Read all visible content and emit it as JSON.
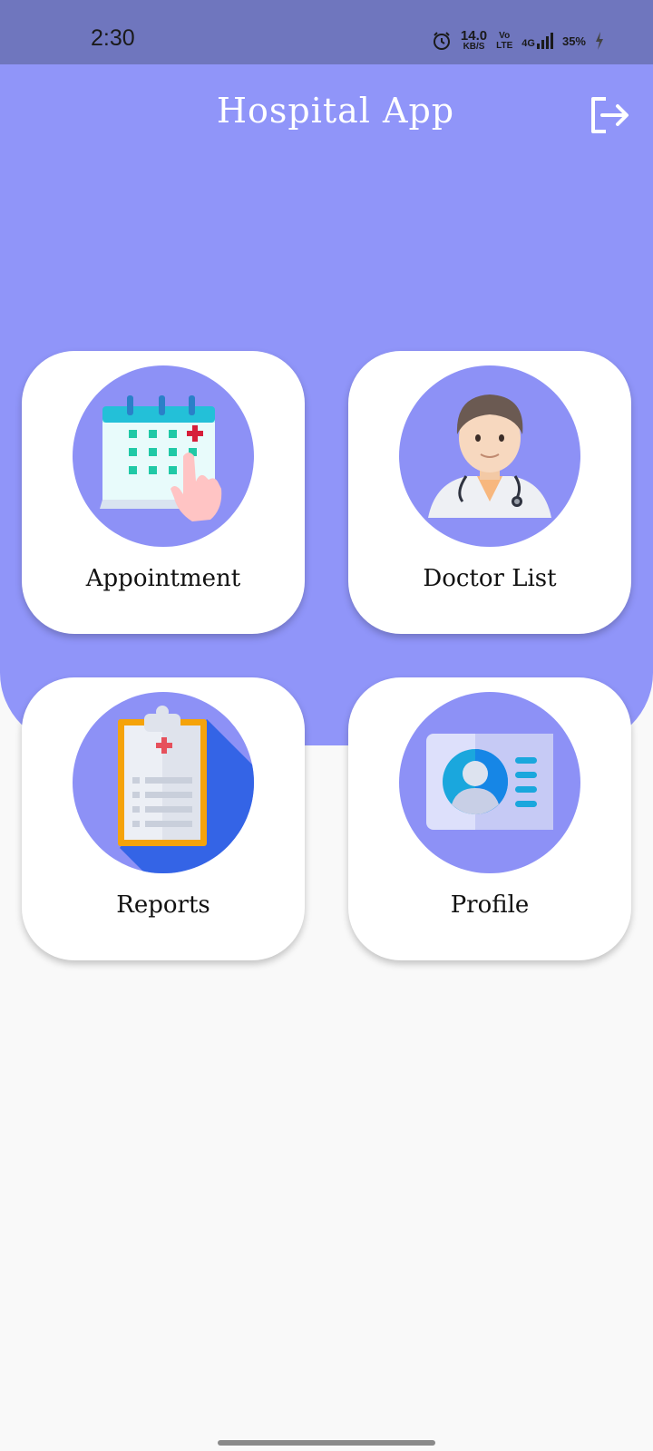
{
  "status_bar": {
    "time": "2:30",
    "speed_value": "14.0",
    "speed_unit": "KB/S",
    "volte_top": "Vo",
    "volte_bottom": "LTE",
    "network": "4G",
    "battery": "35%"
  },
  "header": {
    "title": "Hospital App",
    "logout_icon": "logout-icon"
  },
  "menu": {
    "appointment": {
      "label": "Appointment",
      "icon": "calendar-appointment-icon"
    },
    "doctor_list": {
      "label": "Doctor List",
      "icon": "doctor-icon"
    },
    "reports": {
      "label": "Reports",
      "icon": "clipboard-report-icon"
    },
    "profile": {
      "label": "Profile",
      "icon": "id-card-icon"
    }
  },
  "colors": {
    "status_bar": "#6f76be",
    "header": "#9095f9",
    "icon_circle": "#8d91f6",
    "card": "#ffffff",
    "background": "#f9f9f9"
  }
}
